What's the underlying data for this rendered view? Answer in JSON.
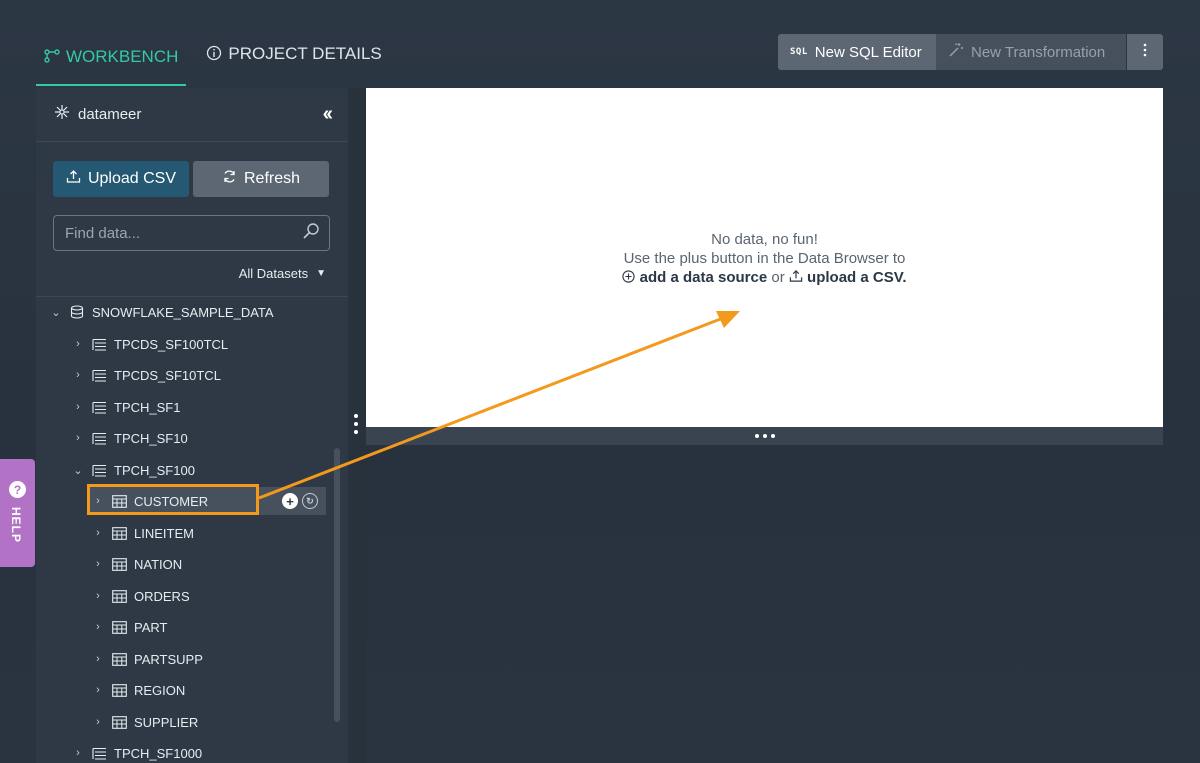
{
  "tabs": [
    {
      "label": "WORKBENCH",
      "icon": "workflow-icon",
      "active": true
    },
    {
      "label": "PROJECT DETAILS",
      "icon": "info-icon",
      "active": false
    }
  ],
  "toolbar": {
    "sql_icon_text": "SQL",
    "new_sql_label": "New SQL Editor",
    "new_transformation_label": "New Transformation",
    "more_icon": "kebab-icon"
  },
  "sidebar": {
    "brand": "datameer",
    "upload_label": "Upload CSV",
    "refresh_label": "Refresh",
    "search_placeholder": "Find data...",
    "datasets_filter": "All Datasets",
    "tree": [
      {
        "label": "SNOWFLAKE_SAMPLE_DATA",
        "type": "database",
        "expanded": true,
        "level": 0
      },
      {
        "label": "TPCDS_SF100TCL",
        "type": "schema",
        "expanded": false,
        "level": 1
      },
      {
        "label": "TPCDS_SF10TCL",
        "type": "schema",
        "expanded": false,
        "level": 1
      },
      {
        "label": "TPCH_SF1",
        "type": "schema",
        "expanded": false,
        "level": 1
      },
      {
        "label": "TPCH_SF10",
        "type": "schema",
        "expanded": false,
        "level": 1
      },
      {
        "label": "TPCH_SF100",
        "type": "schema",
        "expanded": true,
        "level": 1
      },
      {
        "label": "CUSTOMER",
        "type": "table",
        "expanded": false,
        "level": 2,
        "selected": true
      },
      {
        "label": "LINEITEM",
        "type": "table",
        "expanded": false,
        "level": 2
      },
      {
        "label": "NATION",
        "type": "table",
        "expanded": false,
        "level": 2
      },
      {
        "label": "ORDERS",
        "type": "table",
        "expanded": false,
        "level": 2
      },
      {
        "label": "PART",
        "type": "table",
        "expanded": false,
        "level": 2
      },
      {
        "label": "PARTSUPP",
        "type": "table",
        "expanded": false,
        "level": 2
      },
      {
        "label": "REGION",
        "type": "table",
        "expanded": false,
        "level": 2
      },
      {
        "label": "SUPPLIER",
        "type": "table",
        "expanded": false,
        "level": 2
      },
      {
        "label": "TPCH_SF1000",
        "type": "schema",
        "expanded": false,
        "level": 1
      }
    ]
  },
  "preview": {
    "line1": "No data, no fun!",
    "line2": "Use the plus button in the Data Browser to",
    "add_link": "add a data source",
    "or_text": "or",
    "upload_link": "upload a CSV."
  },
  "help": {
    "label": "HELP"
  },
  "colors": {
    "accent": "#35c8a6",
    "annotation": "#f39a1c",
    "help": "#b272c6",
    "upload_button": "#255873"
  }
}
